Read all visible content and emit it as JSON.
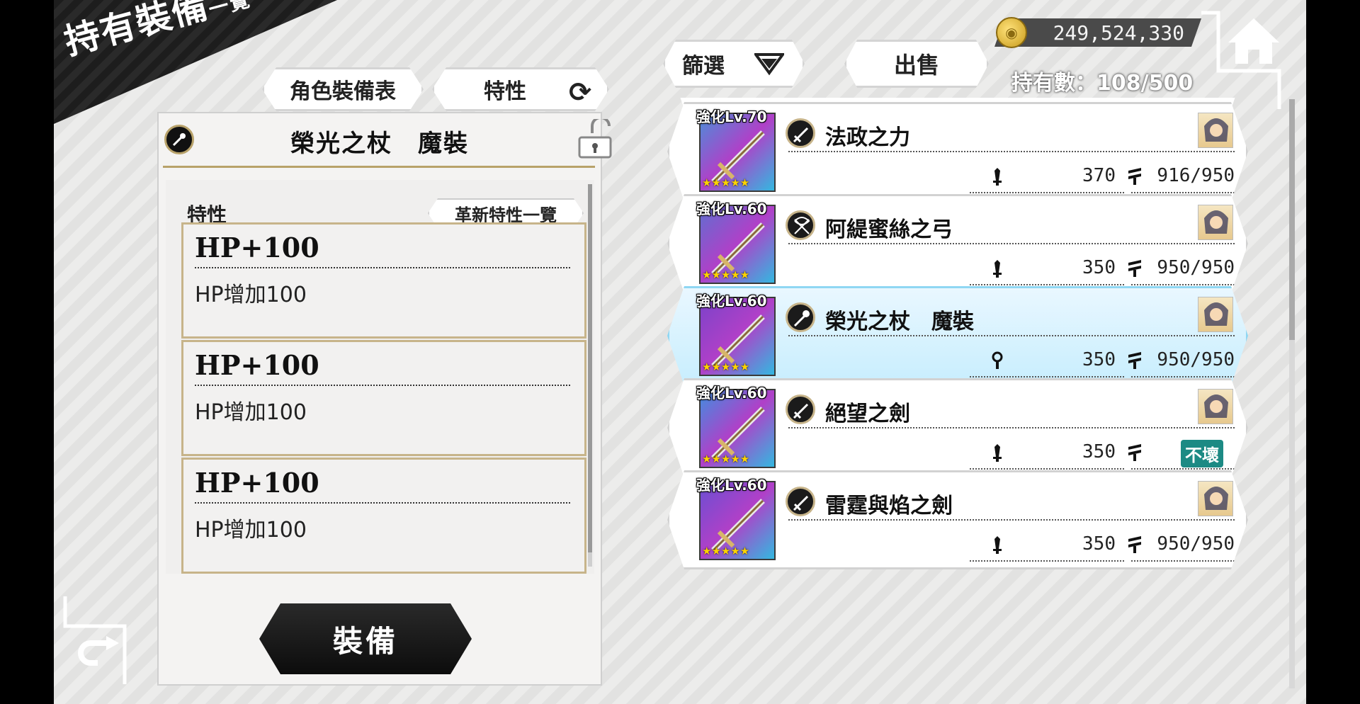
{
  "header": {
    "title_main": "持有裝備",
    "title_sub": "一覽"
  },
  "left_tabs": {
    "char_table_label": "角色裝備表",
    "trait_label": "特性"
  },
  "detail": {
    "item_name": "榮光之杖　魔裝",
    "trait_section_label": "特性",
    "renew_list_label": "革新特性一覽",
    "traits": [
      {
        "title": "HP+100",
        "desc": "HP增加100"
      },
      {
        "title": "HP+100",
        "desc": "HP增加100"
      },
      {
        "title": "HP+100",
        "desc": "HP增加100"
      }
    ],
    "equip_button_label": "裝備"
  },
  "toolbar": {
    "filter_label": "篩選",
    "sell_label": "出售",
    "gold_value": "249,524,330",
    "owned_count": "持有數：108/500"
  },
  "equipment_list": [
    {
      "lv": "強化Lv.70",
      "name": "法政之力",
      "type_icon": "sword-icon",
      "atk": "370",
      "dur": "916/950",
      "unbreakable": false,
      "selected": false,
      "stat_icon": "attack-icon",
      "color": "#4a8fd9"
    },
    {
      "lv": "強化Lv.60",
      "name": "阿緹蜜絲之弓",
      "type_icon": "bow-icon",
      "atk": "350",
      "dur": "950/950",
      "unbreakable": false,
      "selected": false,
      "stat_icon": "attack-icon",
      "color": "#5f6fd0"
    },
    {
      "lv": "強化Lv.60",
      "name": "榮光之杖　魔裝",
      "type_icon": "staff-icon",
      "atk": "350",
      "dur": "950/950",
      "unbreakable": false,
      "selected": true,
      "stat_icon": "magic-icon",
      "color": "#7b43c9"
    },
    {
      "lv": "強化Lv.60",
      "name": "絕望之劍",
      "type_icon": "sword-icon",
      "atk": "350",
      "dur": "",
      "unbreakable": true,
      "unbreakable_label": "不壞",
      "selected": false,
      "stat_icon": "attack-icon",
      "color": "#3f8fe0"
    },
    {
      "lv": "強化Lv.60",
      "name": "雷霆與焰之劍",
      "type_icon": "sword-icon",
      "atk": "350",
      "dur": "950/950",
      "unbreakable": false,
      "selected": false,
      "stat_icon": "attack-icon",
      "color": "#6a4fd2"
    }
  ],
  "stars": "★★★★★",
  "colors": {
    "accent_gold": "#c7b48a",
    "selected_row": "#c8eefe",
    "unbreakable_badge": "#1c8a84"
  }
}
